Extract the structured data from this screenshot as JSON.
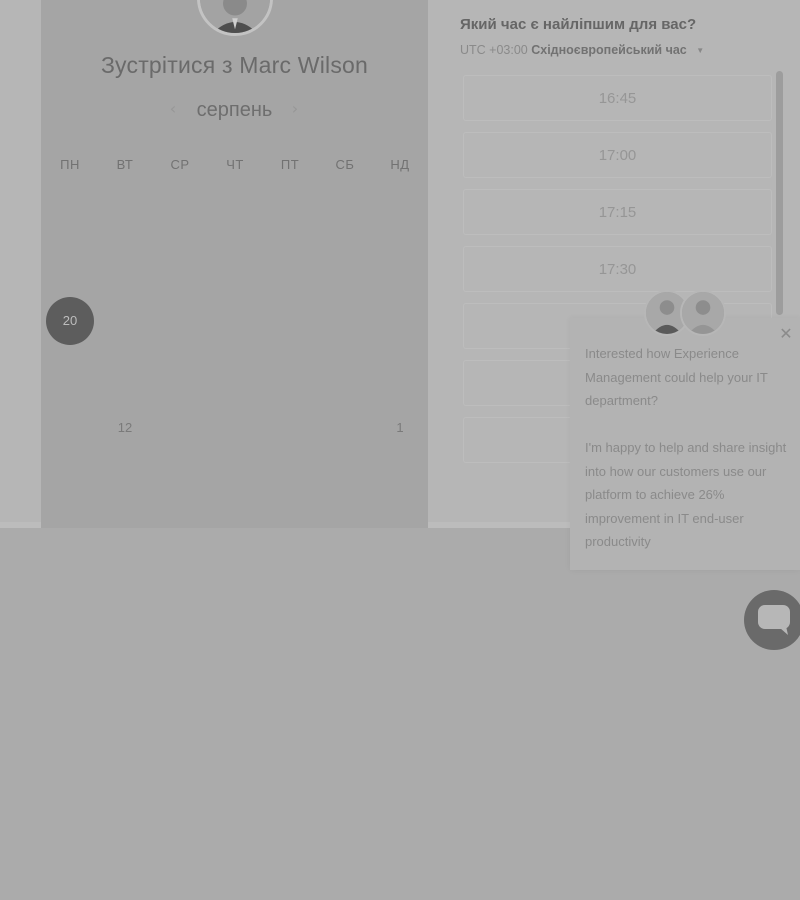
{
  "meeting": {
    "title": "Зустрітися з Marc Wilson",
    "month": "серпень",
    "prev_month_icon": "chevron-left-icon",
    "next_month_icon": "chevron-right-icon"
  },
  "calendar": {
    "weekdays": [
      "ПН",
      "ВТ",
      "СР",
      "ЧТ",
      "ПТ",
      "СБ",
      "НД"
    ],
    "rows": [
      [
        "",
        "",
        "",
        "",
        "",
        "",
        ""
      ],
      [
        "",
        "",
        "",
        "",
        "",
        "",
        ""
      ],
      [
        "20",
        "",
        "",
        "",
        "",
        "",
        ""
      ],
      [
        "",
        "",
        "",
        "",
        "",
        "",
        ""
      ],
      [
        "",
        "12",
        "",
        "",
        "",
        "",
        "1"
      ]
    ],
    "selected_day": "20"
  },
  "time_picker": {
    "heading": "Який час є найліпшим для вас?",
    "timezone_offset": "UTC +03:00",
    "timezone_name": "Східноєвропейський час",
    "slots": [
      "16:45",
      "17:00",
      "17:15",
      "17:30",
      "",
      "",
      ""
    ]
  },
  "chat": {
    "paragraph1": "Interested how Experience Management could help your IT department?",
    "paragraph2": "I'm happy to help and share insight into how our customers use our platform to achieve 26% improvement in IT end-user productivity",
    "close_icon": "close-icon",
    "launcher_icon": "chat-bubble-icon"
  }
}
